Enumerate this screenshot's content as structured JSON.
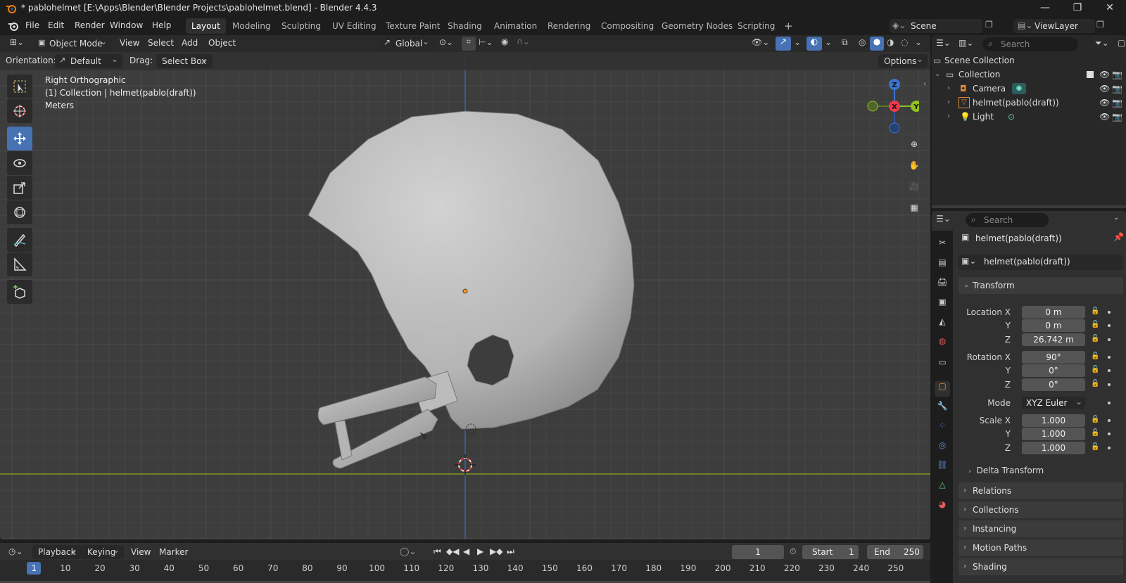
{
  "window": {
    "title": "* pablohelmet [E:\\Apps\\Blender\\Blender Projects\\pablohelmet.blend] - Blender 4.4.3"
  },
  "menu": [
    "File",
    "Edit",
    "Render",
    "Window",
    "Help"
  ],
  "workspaces": [
    {
      "label": "Layout",
      "active": true
    },
    {
      "label": "Modeling"
    },
    {
      "label": "Sculpting"
    },
    {
      "label": "UV Editing"
    },
    {
      "label": "Texture Paint"
    },
    {
      "label": "Shading"
    },
    {
      "label": "Animation"
    },
    {
      "label": "Rendering"
    },
    {
      "label": "Compositing"
    },
    {
      "label": "Geometry Nodes"
    },
    {
      "label": "Scripting"
    }
  ],
  "scene": {
    "label": "Scene",
    "view_layer": "ViewLayer"
  },
  "viewport": {
    "mode": "Object Mode",
    "menus": [
      "View",
      "Select",
      "Add",
      "Object"
    ],
    "transform_orientation": "Global",
    "orientation_label": "Orientation:",
    "orientation_value": "Default",
    "drag_label": "Drag:",
    "drag_value": "Select Box",
    "options_label": "Options",
    "overlay_lines": [
      "Right Orthographic",
      "(1) Collection | helmet(pablo(draft))",
      "Meters"
    ],
    "gizmo_axes": {
      "z": "Z",
      "x": "X",
      "y": "Y"
    }
  },
  "outliner": {
    "search_placeholder": "Search",
    "scene_collection": "Scene Collection",
    "collection": "Collection",
    "items": [
      "Camera",
      "helmet(pablo(draft))",
      "Light"
    ]
  },
  "properties": {
    "search_placeholder": "Search",
    "object_name": "helmet(pablo(draft))",
    "object_field": "helmet(pablo(draft))",
    "transform_header": "Transform",
    "location_label": "Location X",
    "rotation_label": "Rotation X",
    "scale_label": "Scale X",
    "y_label": "Y",
    "z_label": "Z",
    "location": [
      "0 m",
      "0 m",
      "26.742 m"
    ],
    "rotation": [
      "90°",
      "0°",
      "0°"
    ],
    "mode_label": "Mode",
    "mode_value": "XYZ Euler",
    "scale": [
      "1.000",
      "1.000",
      "1.000"
    ],
    "delta_transform": "Delta Transform",
    "panels": [
      "Relations",
      "Collections",
      "Instancing",
      "Motion Paths",
      "Shading"
    ]
  },
  "timeline": {
    "menus": [
      "Playback",
      "Keying",
      "View",
      "Marker"
    ],
    "current_frame": "1",
    "start_label": "Start",
    "start_value": "1",
    "end_label": "End",
    "end_value": "250",
    "ruler": [
      "1",
      "10",
      "20",
      "30",
      "40",
      "50",
      "60",
      "70",
      "80",
      "90",
      "100",
      "110",
      "120",
      "130",
      "140",
      "150",
      "160",
      "170",
      "180",
      "190",
      "200",
      "210",
      "220",
      "230",
      "240",
      "250"
    ]
  }
}
